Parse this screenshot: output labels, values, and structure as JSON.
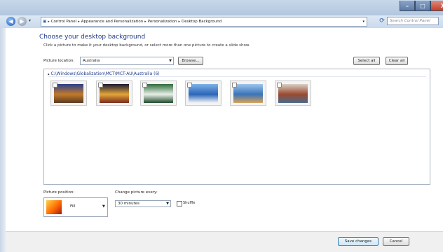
{
  "window": {
    "controls": {
      "minimize": "–",
      "maximize": "□",
      "close": "X"
    }
  },
  "nav": {
    "back_icon": "back-arrow-icon",
    "forward_icon": "forward-arrow-icon",
    "breadcrumbs": [
      "Control Panel",
      "Appearance and Personalization",
      "Personalization",
      "Desktop Background"
    ],
    "search_placeholder": "Search Control Panel"
  },
  "page": {
    "title": "Choose your desktop background",
    "subtitle": "Click a picture to make it your desktop background, or select more than one picture to create a slide show."
  },
  "location": {
    "label": "Picture location:",
    "value": "Australia",
    "browse_label": "Browse...",
    "select_all_label": "Select all",
    "clear_all_label": "Clear all"
  },
  "gallery": {
    "folder_label": "C:\\Windows\\Globalization\\MCT\\MCT-AU\\Australia (6)",
    "thumbnails": [
      {
        "name": "australia-1",
        "colors": [
          "#2b3f8a",
          "#c27a2c",
          "#5a3a20"
        ]
      },
      {
        "name": "australia-2",
        "colors": [
          "#1b1a33",
          "#e3a53a",
          "#7a2a1a"
        ]
      },
      {
        "name": "australia-3",
        "colors": [
          "#2e6b3a",
          "#e8f0e8",
          "#1f4a2a"
        ]
      },
      {
        "name": "australia-4",
        "colors": [
          "#7fb2e6",
          "#2a66b8",
          "#f5f5f5"
        ]
      },
      {
        "name": "australia-5",
        "colors": [
          "#9ec5ee",
          "#3a73b8",
          "#d7a35a"
        ]
      },
      {
        "name": "australia-6",
        "colors": [
          "#d9d1c4",
          "#9a4a30",
          "#4a6a8a"
        ]
      }
    ]
  },
  "position": {
    "label": "Picture position:",
    "value": "Fill"
  },
  "change": {
    "label": "Change picture every:",
    "value": "30 minutes",
    "shuffle_label": "Shuffle"
  },
  "footer": {
    "save_label": "Save changes",
    "cancel_label": "Cancel"
  }
}
